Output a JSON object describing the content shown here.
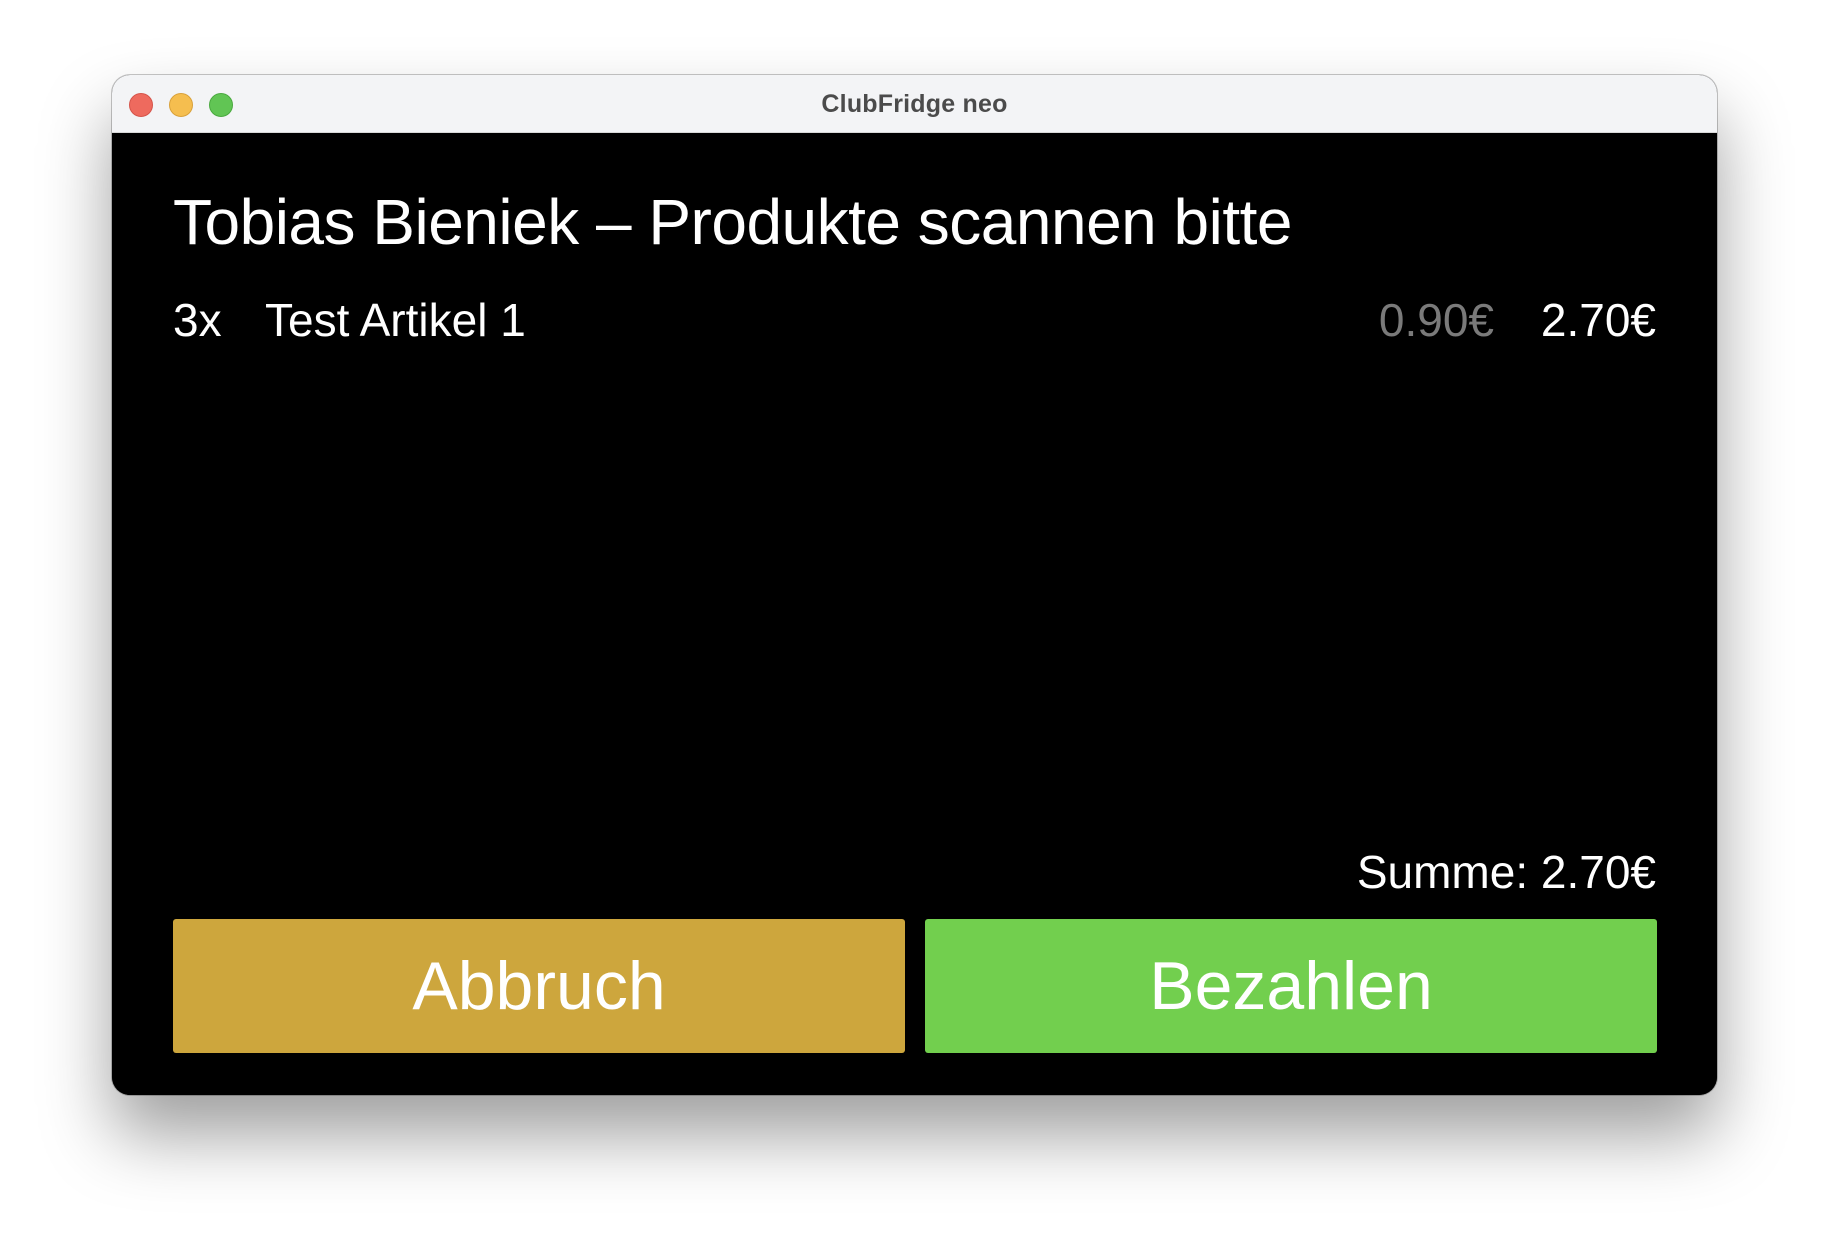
{
  "window": {
    "title": "ClubFridge neo"
  },
  "main": {
    "heading": "Tobias Bieniek – Produkte scannen bitte",
    "items": [
      {
        "quantity": "3x",
        "name": "Test Artikel 1",
        "unit_price": "0.90€",
        "total_price": "2.70€"
      }
    ],
    "sum_label": "Summe: 2.70€"
  },
  "actions": {
    "cancel_label": "Abbruch",
    "pay_label": "Bezahlen"
  },
  "colors": {
    "cancel_button": "#cda63d",
    "pay_button": "#72cf4e",
    "background": "#000000",
    "muted_text": "#7a7a7a"
  },
  "icons": [
    "close-window-icon",
    "minimize-window-icon",
    "zoom-window-icon"
  ]
}
